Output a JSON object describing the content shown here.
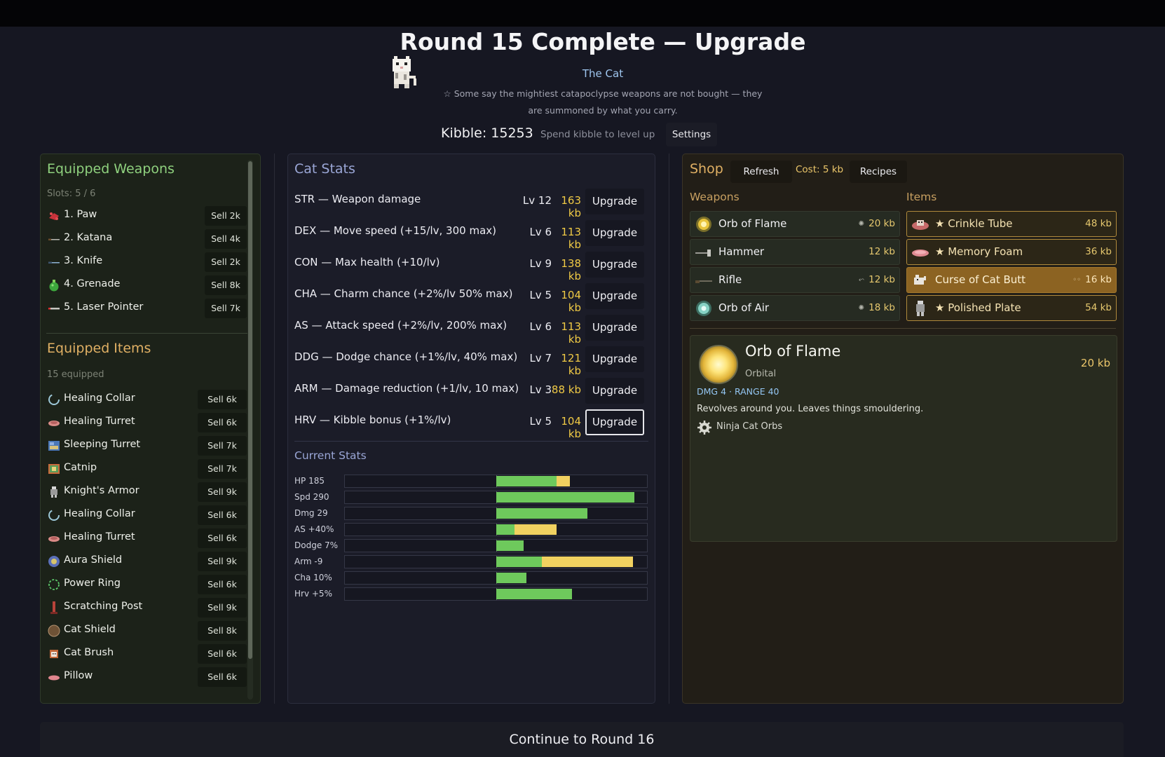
{
  "header": {
    "title": "Round 15 Complete — Upgrade",
    "character_name": "The Cat",
    "quote": "☆ Some say the mightiest catapoclypse weapons are not bought — they are summoned by what you carry.",
    "kibble": "Kibble: 15253",
    "spend_hint": "Spend kibble to level up",
    "settings_label": "Settings"
  },
  "weapons_panel": {
    "title": "Equipped Weapons",
    "slots": "Slots: 5 / 6",
    "weapons": [
      {
        "name": "1. Paw",
        "sell": "Sell 2k",
        "icon": "paw-icon"
      },
      {
        "name": "2. Katana",
        "sell": "Sell 4k",
        "icon": "katana-icon"
      },
      {
        "name": "3. Knife",
        "sell": "Sell 2k",
        "icon": "knife-icon"
      },
      {
        "name": "4. Grenade",
        "sell": "Sell 8k",
        "icon": "grenade-icon"
      },
      {
        "name": "5. Laser Pointer",
        "sell": "Sell 7k",
        "icon": "laser-pointer-icon"
      }
    ]
  },
  "items_panel": {
    "title": "Equipped Items",
    "count": "15 equipped",
    "items": [
      {
        "name": "Healing Collar",
        "sell": "Sell 6k",
        "icon": "collar-icon"
      },
      {
        "name": "Healing Turret",
        "sell": "Sell 6k",
        "icon": "turret-icon"
      },
      {
        "name": "Sleeping Turret",
        "sell": "Sell 7k",
        "icon": "sleeping-turret-icon"
      },
      {
        "name": "Catnip",
        "sell": "Sell 7k",
        "icon": "catnip-icon"
      },
      {
        "name": "Knight's Armor",
        "sell": "Sell 9k",
        "icon": "armor-icon"
      },
      {
        "name": "Healing Collar",
        "sell": "Sell 6k",
        "icon": "collar-icon"
      },
      {
        "name": "Healing Turret",
        "sell": "Sell 6k",
        "icon": "turret-icon"
      },
      {
        "name": "Aura Shield",
        "sell": "Sell 9k",
        "icon": "aura-shield-icon"
      },
      {
        "name": "Power Ring",
        "sell": "Sell 6k",
        "icon": "ring-icon"
      },
      {
        "name": "Scratching Post",
        "sell": "Sell 9k",
        "icon": "scratching-post-icon"
      },
      {
        "name": "Cat Shield",
        "sell": "Sell 8k",
        "icon": "shield-icon"
      },
      {
        "name": "Cat Brush",
        "sell": "Sell 6k",
        "icon": "brush-icon"
      },
      {
        "name": "Pillow",
        "sell": "Sell 6k",
        "icon": "pillow-icon"
      }
    ]
  },
  "cat_stats": {
    "title": "Cat Stats",
    "rows": [
      {
        "label": "STR — Weapon damage",
        "level": "Lv 12",
        "cost": "163 kb",
        "button": "Upgrade"
      },
      {
        "label": "DEX — Move speed (+15/lv, 300 max)",
        "level": "Lv 6",
        "cost": "113 kb",
        "button": "Upgrade"
      },
      {
        "label": "CON — Max health (+10/lv)",
        "level": "Lv 9",
        "cost": "138 kb",
        "button": "Upgrade"
      },
      {
        "label": "CHA — Charm chance (+2%/lv 50% max)",
        "level": "Lv 5",
        "cost": "104 kb",
        "button": "Upgrade"
      },
      {
        "label": "AS — Attack speed (+2%/lv, 200% max)",
        "level": "Lv 6",
        "cost": "113 kb",
        "button": "Upgrade"
      },
      {
        "label": "DDG — Dodge chance (+1%/lv, 40% max)",
        "level": "Lv 7",
        "cost": "121 kb",
        "button": "Upgrade"
      },
      {
        "label": "ARM — Damage reduction (+1/lv, 10 max)",
        "level": "Lv 3",
        "cost": "88 kb",
        "button": "Upgrade"
      },
      {
        "label": "HRV — Kibble bonus (+1%/lv)",
        "level": "Lv 5",
        "cost": "104 kb",
        "button": "Upgrade"
      }
    ]
  },
  "current_stats": {
    "title": "Current Stats",
    "bars": [
      {
        "label": "HP 185",
        "green": 0.4,
        "yellow": 0.09
      },
      {
        "label": "Spd 290",
        "green": 0.91,
        "yellow": 0
      },
      {
        "label": "Dmg 29",
        "green": 0.6,
        "yellow": 0
      },
      {
        "label": "AS +40%",
        "green": 0.12,
        "yellow": 0.28
      },
      {
        "label": "Dodge 7%",
        "green": 0.18,
        "yellow": 0
      },
      {
        "label": "Arm -9",
        "green": 0.3,
        "yellow": 0.6
      },
      {
        "label": "Cha 10%",
        "green": 0.2,
        "yellow": 0
      },
      {
        "label": "Hrv +5%",
        "green": 0.5,
        "yellow": 0
      }
    ]
  },
  "shop": {
    "title": "Shop",
    "refresh_label": "Refresh",
    "cost": "Cost: 5 kb",
    "recipes_label": "Recipes",
    "weapons_title": "Weapons",
    "items_title": "Items",
    "weapons": [
      {
        "name": "Orb of Flame",
        "price": "20 kb",
        "icon": "orb-of-flame-icon",
        "mini_icon": "gear-icon"
      },
      {
        "name": "Hammer",
        "price": "12 kb",
        "icon": "hammer-icon",
        "mini_icon": ""
      },
      {
        "name": "Rifle",
        "price": "12 kb",
        "icon": "rifle-icon",
        "mini_icon": "rifle-mini-icon"
      },
      {
        "name": "Orb of Air",
        "price": "18 kb",
        "icon": "orb-of-air-icon",
        "mini_icon": "gear-icon"
      }
    ],
    "items": [
      {
        "name": "★ Crinkle Tube",
        "price": "48 kb",
        "icon": "crinkle-tube-icon"
      },
      {
        "name": "★ Memory Foam",
        "price": "36 kb",
        "icon": "memory-foam-icon"
      },
      {
        "name": "Curse of Cat Butt",
        "price": "16 kb",
        "icon": "curse-icon"
      },
      {
        "name": "★ Polished Plate",
        "price": "54 kb",
        "icon": "plate-armor-icon"
      }
    ],
    "detail": {
      "name": "Orb of Flame",
      "type": "Orbital",
      "price": "20 kb",
      "stats": "DMG 4 · RANGE 40",
      "description": "Revolves around you. Leaves things smouldering.",
      "set_name": "Ninja Cat Orbs"
    }
  },
  "footer": {
    "continue_label": "Continue to Round 16"
  }
}
